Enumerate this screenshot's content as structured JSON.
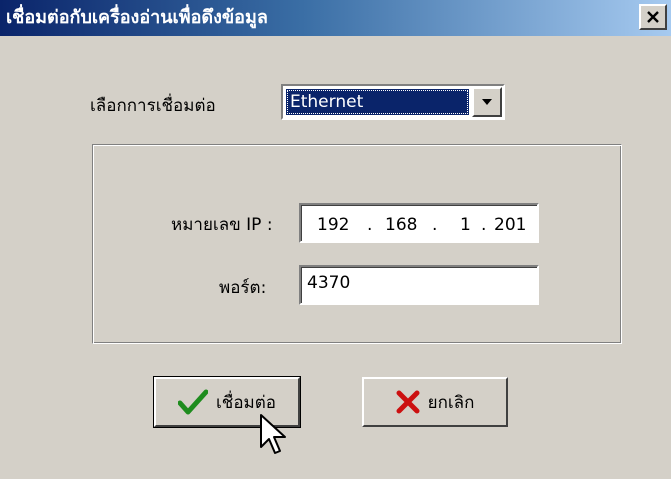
{
  "window": {
    "title": "เชื่อมต่อกับเครื่องอ่านเพื่อดึงข้อมูล",
    "close_label": "×"
  },
  "connection": {
    "label": "เลือกการเชื่อมต่อ",
    "selected": "Ethernet"
  },
  "network": {
    "ip_label": "หมายเลข IP :",
    "ip_octets": [
      "192",
      "168",
      "1",
      "201"
    ],
    "ip_sep": ".",
    "port_label": "พอร์ต:",
    "port_value": "4370"
  },
  "buttons": {
    "connect_label": "เชื่อมต่อ",
    "cancel_label": "ยกเลิก"
  },
  "icons": {
    "check": "check-icon",
    "cancel": "x-icon",
    "cursor": "mouse-pointer-icon"
  },
  "colors": {
    "titlebar_start": "#0a246a",
    "titlebar_end": "#a6caf0",
    "face": "#d4d0c8",
    "check": "#1e8c1e",
    "cancel": "#cc1010"
  }
}
